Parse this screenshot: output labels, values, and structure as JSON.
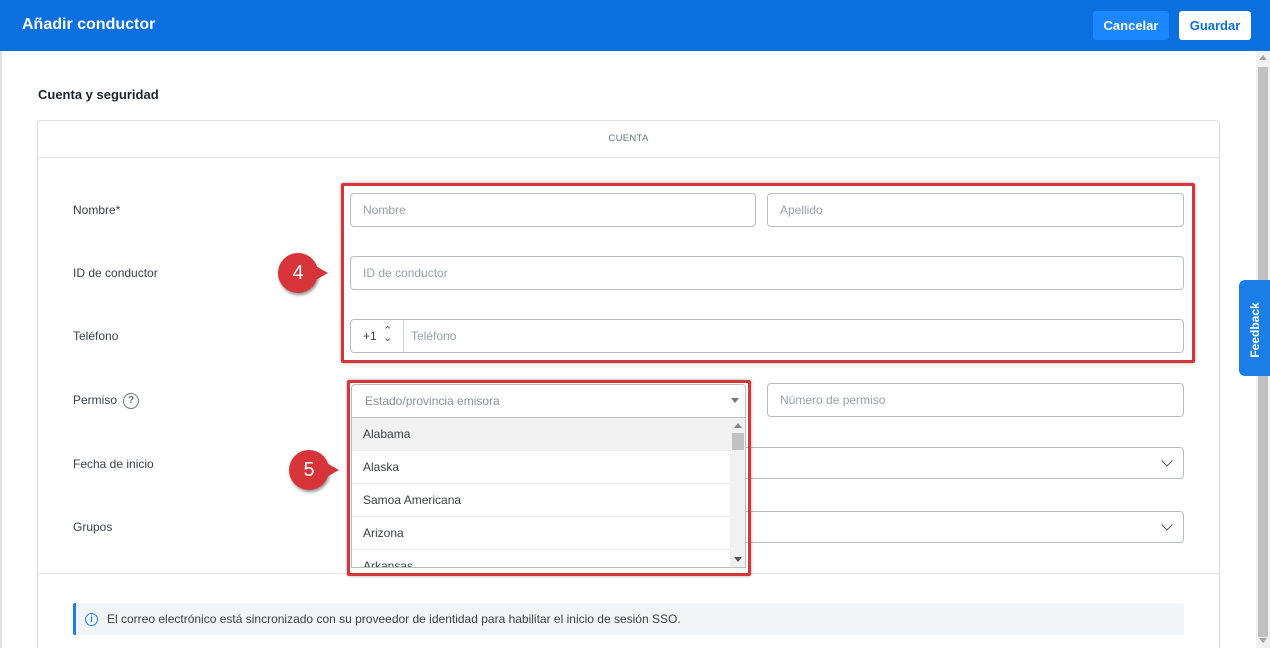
{
  "header": {
    "title": "Añadir conductor",
    "cancel_label": "Cancelar",
    "save_label": "Guardar"
  },
  "section": {
    "title": "Cuenta y seguridad",
    "card_header": "CUENTA"
  },
  "form": {
    "name_label": "Nombre*",
    "first_name_placeholder": "Nombre",
    "last_name_placeholder": "Apellido",
    "driver_id_label": "ID de conductor",
    "driver_id_placeholder": "ID de conductor",
    "phone_label": "Teléfono",
    "phone_code": "+1",
    "phone_placeholder": "Teléfono",
    "license_label": "Permiso",
    "license_help": "?",
    "state_placeholder": "Estado/provincia emisora",
    "license_number_placeholder": "Número de permiso",
    "start_date_label": "Fecha de inicio",
    "groups_label": "Grupos"
  },
  "dropdown": {
    "options": [
      "Alabama",
      "Alaska",
      "Samoa Americana",
      "Arizona",
      "Arkansas"
    ],
    "highlighted": "Alabama"
  },
  "info": {
    "icon": "i",
    "text": "El correo electrónico está sincronizado con su proveedor de identidad para habilitar el inicio de sesión SSO."
  },
  "callouts": {
    "first": "4",
    "second": "5"
  },
  "feedback": {
    "label": "Feedback"
  },
  "colors": {
    "header_bg": "#0a6fdf",
    "cancel_bg": "#1a86ff",
    "highlight_red": "#d4363a",
    "feedback_bg": "#1a7ee8"
  }
}
